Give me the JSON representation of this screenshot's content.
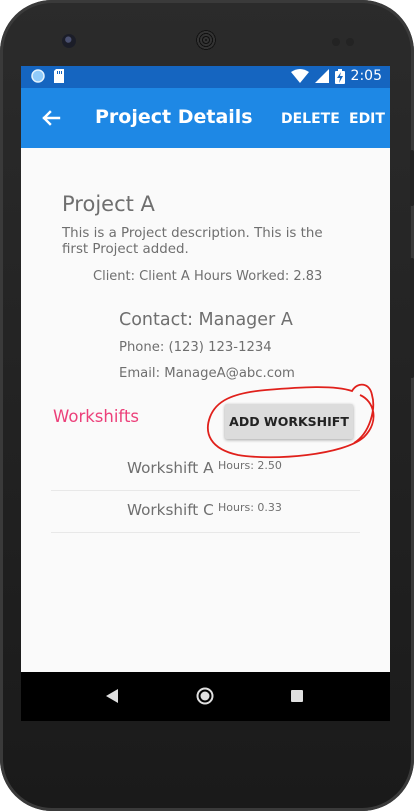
{
  "colors": {
    "status_bar": "#1565c0",
    "app_bar": "#1e88e5",
    "accent_pink": "#ec407a",
    "annotation_red": "#e0201b",
    "body_text": "#6f6f6f"
  },
  "status_bar": {
    "time": "2:05",
    "icons": [
      "notification-circle-icon",
      "sd-card-icon",
      "wifi-icon",
      "cell-signal-icon",
      "battery-charging-icon"
    ]
  },
  "app_bar": {
    "title": "Project Details",
    "back_icon": "arrow-back-icon",
    "delete_label": "DELETE",
    "edit_label": "EDIT"
  },
  "project": {
    "name": "Project A",
    "description": "This is a Project description. This is the first Project added.",
    "client_line": "Client: Client A  Hours Worked: 2.83"
  },
  "contact": {
    "title": "Contact: Manager A",
    "phone": "Phone: (123) 123-1234",
    "email": "Email: ManageA@abc.com"
  },
  "workshifts": {
    "label": "Workshifts",
    "add_button_label": "ADD WORKSHIFT",
    "items": [
      {
        "name": "Workshift A",
        "hours": "Hours: 2.50"
      },
      {
        "name": "Workshift C",
        "hours": "Hours: 0.33"
      }
    ]
  },
  "nav_bar": {
    "icons": [
      "nav-back-icon",
      "nav-home-icon",
      "nav-recents-icon"
    ]
  }
}
